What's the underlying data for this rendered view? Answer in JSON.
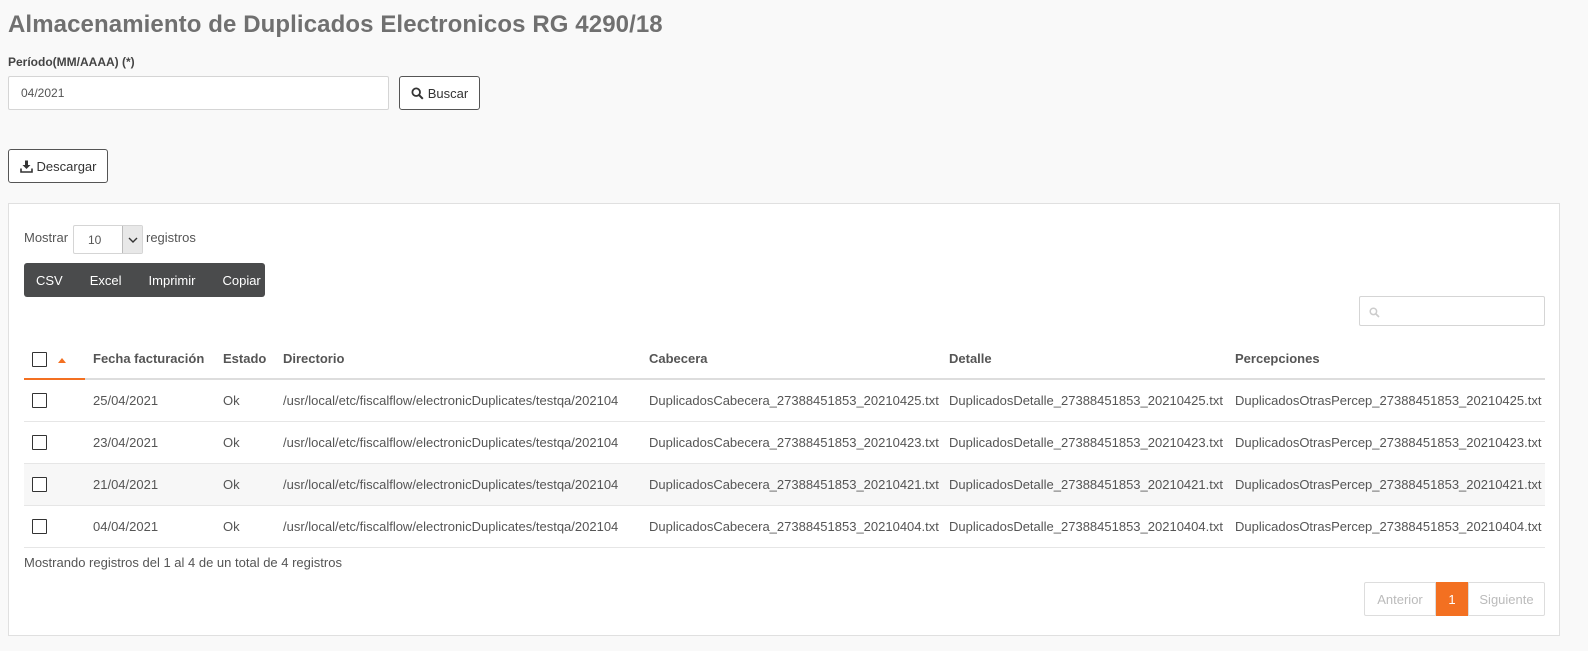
{
  "page": {
    "title": "Almacenamiento de Duplicados Electronicos RG 4290/18"
  },
  "form": {
    "period_label": "Período(MM/AAAA) (*)",
    "period_value": "04/2021",
    "search_button": "Buscar",
    "search_icon": "search-icon"
  },
  "toolbar": {
    "download_button": "Descargar",
    "download_icon": "download-icon"
  },
  "table_controls": {
    "show_label": "Mostrar",
    "page_length": "10",
    "records_label": "registros",
    "export_buttons": [
      "CSV",
      "Excel",
      "Imprimir",
      "Copiar"
    ],
    "filter_placeholder": ""
  },
  "table": {
    "columns": [
      "Fecha facturación",
      "Estado",
      "Directorio",
      "Cabecera",
      "Detalle",
      "Percepciones"
    ],
    "sorted_column": "select",
    "rows": [
      {
        "fecha": "25/04/2021",
        "estado": "Ok",
        "directorio": "/usr/local/etc/fiscalflow/electronicDuplicates/testqa/202104",
        "cabecera": "DuplicadosCabecera_27388451853_20210425.txt",
        "detalle": "DuplicadosDetalle_27388451853_20210425.txt",
        "percepciones": "DuplicadosOtrasPercep_27388451853_20210425.txt"
      },
      {
        "fecha": "23/04/2021",
        "estado": "Ok",
        "directorio": "/usr/local/etc/fiscalflow/electronicDuplicates/testqa/202104",
        "cabecera": "DuplicadosCabecera_27388451853_20210423.txt",
        "detalle": "DuplicadosDetalle_27388451853_20210423.txt",
        "percepciones": "DuplicadosOtrasPercep_27388451853_20210423.txt"
      },
      {
        "fecha": "21/04/2021",
        "estado": "Ok",
        "directorio": "/usr/local/etc/fiscalflow/electronicDuplicates/testqa/202104",
        "cabecera": "DuplicadosCabecera_27388451853_20210421.txt",
        "detalle": "DuplicadosDetalle_27388451853_20210421.txt",
        "percepciones": "DuplicadosOtrasPercep_27388451853_20210421.txt"
      },
      {
        "fecha": "04/04/2021",
        "estado": "Ok",
        "directorio": "/usr/local/etc/fiscalflow/electronicDuplicates/testqa/202104",
        "cabecera": "DuplicadosCabecera_27388451853_20210404.txt",
        "detalle": "DuplicadosDetalle_27388451853_20210404.txt",
        "percepciones": "DuplicadosOtrasPercep_27388451853_20210404.txt"
      }
    ]
  },
  "footer": {
    "info": "Mostrando registros del 1 al 4 de un total de 4 registros",
    "prev": "Anterior",
    "current_page": "1",
    "next": "Siguiente"
  },
  "colors": {
    "accent": "#f37021",
    "export_bar": "#4a4b4c",
    "title": "#707070"
  }
}
